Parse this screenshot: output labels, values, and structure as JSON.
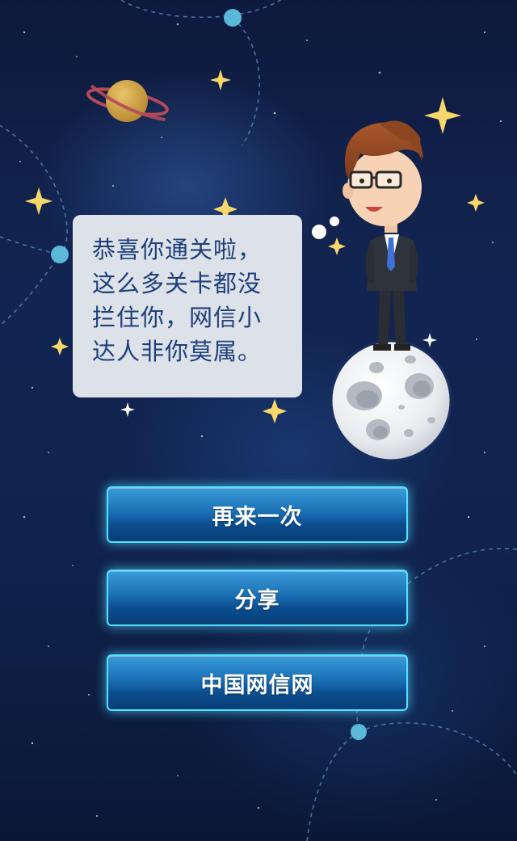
{
  "speech": {
    "lines": [
      "恭喜你通关啦，",
      "这么多关卡都没",
      "拦住你，网信小",
      "达人非你莫属。"
    ]
  },
  "buttons": {
    "retry": "再来一次",
    "share": "分享",
    "cac": "中国网信网"
  },
  "colors": {
    "background": "#122552",
    "speech_bubble": "#dde1e8",
    "speech_text": "#1d3f7a",
    "button_border": "#55e0ff",
    "button_fill": "#1b6fb5",
    "star": "#f7d66a"
  },
  "icons": [
    "planet-icon",
    "moon-icon",
    "star-icon",
    "cartoon-boy-icon"
  ]
}
